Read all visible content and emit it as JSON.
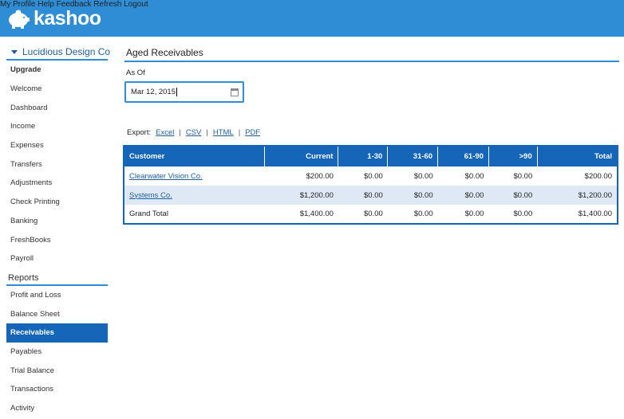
{
  "brand": {
    "name": "kashoo"
  },
  "topnav": [
    "My Profile",
    "Help",
    "Feedback",
    "Refresh",
    "Logout"
  ],
  "sidebar": {
    "company": "Lucidious Design Co",
    "items": [
      "Upgrade",
      "Welcome",
      "Dashboard",
      "Income",
      "Expenses",
      "Transfers",
      "Adjustments",
      "Check Printing",
      "Banking",
      "FreshBooks",
      "Payroll"
    ],
    "reports_label": "Reports",
    "reports": [
      "Profit and Loss",
      "Balance Sheet",
      "Receivables",
      "Payables",
      "Trial Balance",
      "Transactions",
      "Activity"
    ]
  },
  "main": {
    "title": "Aged Receivables",
    "asof_label": "As Of",
    "asof_value": "Mar 12, 2015",
    "export_label": "Export:",
    "export_links": [
      "Excel",
      "CSV",
      "HTML",
      "PDF"
    ]
  },
  "table": {
    "headers": [
      "Customer",
      "Current",
      "1-30",
      "31-60",
      "61-90",
      ">90",
      "Total"
    ],
    "rows": [
      [
        "Clearwater Vision Co.",
        "$200.00",
        "$0.00",
        "$0.00",
        "$0.00",
        "$0.00",
        "$200.00"
      ],
      [
        "Systems Co.",
        "$1,200.00",
        "$0.00",
        "$0.00",
        "$0.00",
        "$0.00",
        "$1,200.00"
      ],
      [
        "Grand Total",
        "$1,400.00",
        "$0.00",
        "$0.00",
        "$0.00",
        "$0.00",
        "$1,400.00"
      ]
    ]
  },
  "colors": {
    "header": "#2f8dd6",
    "accent": "#1565b8",
    "row_alt": "#dfe9f5",
    "link": "#1f5fa0"
  }
}
